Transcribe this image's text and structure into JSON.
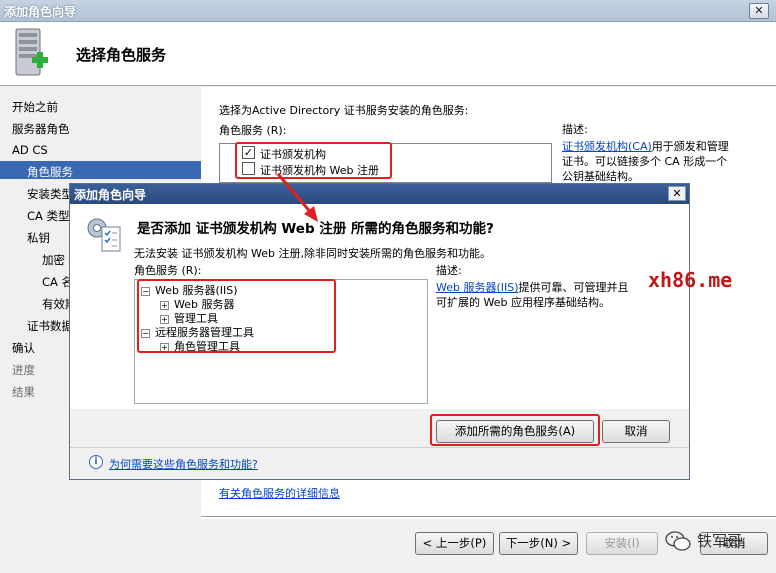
{
  "main_window": {
    "title": "添加角色向导",
    "close_glyph": "✕",
    "header_title": "选择角色服务",
    "nav": [
      {
        "label": "开始之前",
        "state": "normal"
      },
      {
        "label": "服务器角色",
        "state": "normal"
      },
      {
        "label": "AD CS",
        "state": "normal"
      },
      {
        "label": "角色服务",
        "state": "selected"
      },
      {
        "label": "安装类型",
        "state": "normal"
      },
      {
        "label": "CA 类型",
        "state": "normal"
      },
      {
        "label": "私钥",
        "state": "normal"
      },
      {
        "label": "加密",
        "state": "normal"
      },
      {
        "label": "CA 名",
        "state": "normal"
      },
      {
        "label": "有效期",
        "state": "normal"
      },
      {
        "label": "证书数据",
        "state": "normal"
      },
      {
        "label": "确认",
        "state": "normal"
      },
      {
        "label": "进度",
        "state": "muted"
      },
      {
        "label": "结果",
        "state": "muted"
      }
    ],
    "instruction": "选择为Active Directory 证书服务安装的角色服务:",
    "role_services_label": "角色服务 (R):",
    "role_services": [
      {
        "label": "证书颁发机构",
        "checked": true
      },
      {
        "label": "证书颁发机构 Web 注册",
        "checked": false
      }
    ],
    "description_label": "描述:",
    "description_link": "证书颁发机构(CA)",
    "description_text_1": "用于颁发和管理",
    "description_text_2": "证书。可以链接多个 CA 形成一个",
    "description_text_3": "公钥基础结构。",
    "more_info_link": "有关角色服务的详细信息",
    "buttons": {
      "back": "< 上一步(P)",
      "next": "下一步(N) >",
      "install": "安装(I)",
      "cancel": "取消"
    }
  },
  "dialog": {
    "title": "添加角色向导",
    "close_glyph": "✕",
    "heading": "是否添加 证书颁发机构 Web 注册 所需的角色服务和功能?",
    "message": "无法安装 证书颁发机构 Web 注册,除非同时安装所需的角色服务和功能。",
    "role_services_label": "角色服务 (R):",
    "tree": [
      {
        "label": "Web 服务器(IIS)",
        "level": 0,
        "expander": "⊟"
      },
      {
        "label": "Web 服务器",
        "level": 1,
        "expander": "⊞"
      },
      {
        "label": "管理工具",
        "level": 1,
        "expander": "⊞"
      },
      {
        "label": "远程服务器管理工具",
        "level": 0,
        "expander": "⊟"
      },
      {
        "label": "角色管理工具",
        "level": 1,
        "expander": "⊞"
      }
    ],
    "description_label": "描述:",
    "description_link": "Web 服务器(IIS)",
    "description_text_1": "提供可靠、可管理并且",
    "description_text_2": "可扩展的 Web 应用程序基础结构。",
    "add_button": "添加所需的角色服务(A)",
    "cancel_button": "取消",
    "help_link": "为何需要这些角色服务和功能?",
    "info_glyph": "i"
  },
  "watermarks": {
    "site": "xh86.me",
    "author": "铁军哥"
  },
  "colors": {
    "highlight_red": "#e02020",
    "nav_selected": "#3a69b3",
    "link_blue": "#0645c5",
    "dialog_title": "#2a4a7e"
  }
}
